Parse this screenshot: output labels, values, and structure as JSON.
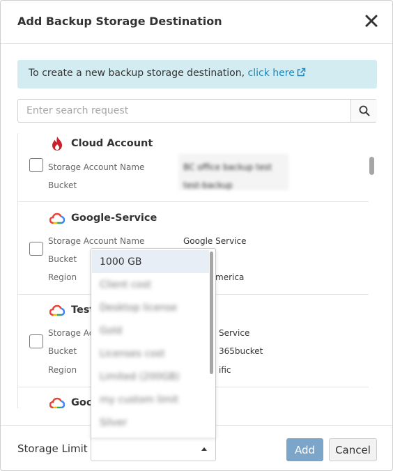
{
  "dialog": {
    "title": "Add Backup Storage Destination",
    "close_symbol": "✕"
  },
  "info": {
    "text": "To create a new backup storage destination, ",
    "link": "click here",
    "icon": "external-link-icon"
  },
  "search": {
    "placeholder": "Enter search request",
    "value": "",
    "icon": "search-icon"
  },
  "destinations": [
    {
      "name": "Cloud Account",
      "icon": "cloud-account-logo",
      "fields": [
        {
          "key": "Storage Account Name",
          "value": "BC office backup test"
        },
        {
          "key": "Bucket",
          "value": "test-backup"
        }
      ]
    },
    {
      "name": "Google-Service",
      "icon": "google-cloud-logo",
      "fields": [
        {
          "key": "Storage Account Name",
          "value": "Google Service"
        },
        {
          "key": "Bucket",
          "value": ""
        },
        {
          "key": "Region",
          "value": "merica"
        }
      ]
    },
    {
      "name": "Test",
      "icon": "google-cloud-logo",
      "fields": [
        {
          "key": "Storage Ac",
          "value": "Service"
        },
        {
          "key": "Bucket",
          "value": "365bucket"
        },
        {
          "key": "Region",
          "value": "ific"
        }
      ]
    },
    {
      "name": "Goo",
      "icon": "google-cloud-logo",
      "fields": []
    }
  ],
  "storage_limit": {
    "label": "Storage Limit",
    "selected": "",
    "options": [
      "1000 GB",
      "Client cost",
      "Desktop license",
      "Gold",
      "Licenses cost",
      "Limited (200GB)",
      "my custom limit",
      "Silver"
    ]
  },
  "footer": {
    "add_label": "Add",
    "cancel_label": "Cancel"
  },
  "colors": {
    "info_bg": "#d3ecf2",
    "link": "#1f86b6",
    "add_button": "#7ba5c9",
    "cloud_account_red": "#c8202c"
  }
}
